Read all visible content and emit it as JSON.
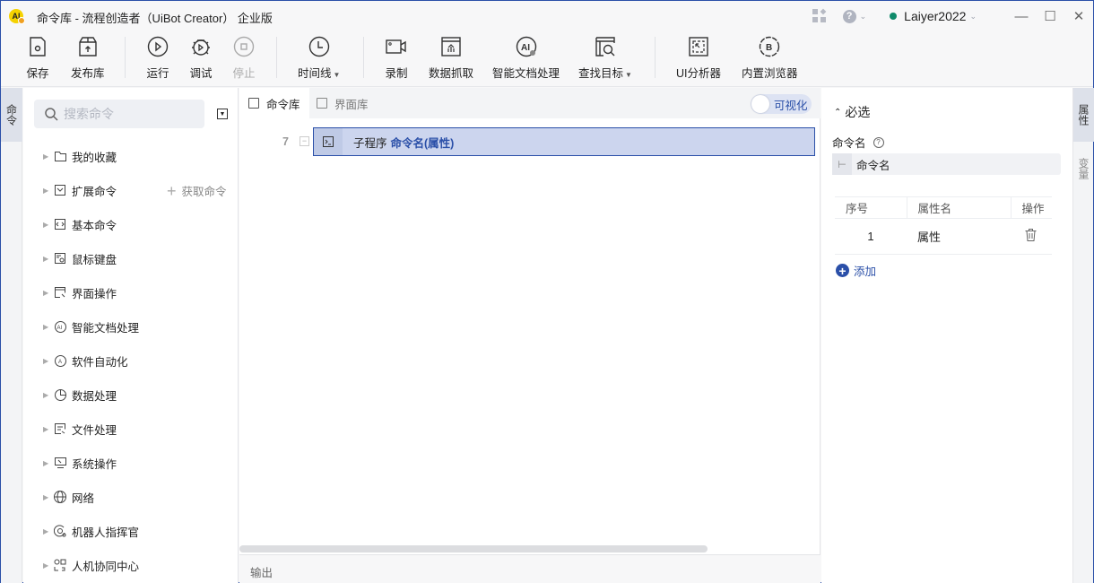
{
  "window": {
    "title": "命令库 - 流程创造者（UiBot Creator） 企业版",
    "logo_text": "Al",
    "user": "Laiyer2022",
    "status_color": "#0f8a6a"
  },
  "toolbar": {
    "items": [
      {
        "id": "save",
        "label": "保存",
        "icon": "save-icon"
      },
      {
        "id": "publish",
        "label": "发布库",
        "icon": "publish-box-icon"
      },
      {
        "id": "run",
        "label": "运行",
        "icon": "play-icon"
      },
      {
        "id": "debug",
        "label": "调试",
        "icon": "bug-icon"
      },
      {
        "id": "stop",
        "label": "停止",
        "icon": "stop-icon",
        "disabled": true
      },
      {
        "id": "timeline",
        "label": "时间线",
        "icon": "clock-icon",
        "dropdown": true
      },
      {
        "id": "record",
        "label": "录制",
        "icon": "camera-icon"
      },
      {
        "id": "scrape",
        "label": "数据抓取",
        "icon": "data-scrape-icon"
      },
      {
        "id": "idp",
        "label": "智能文档处理",
        "icon": "ai-doc-icon"
      },
      {
        "id": "find_target",
        "label": "查找目标",
        "icon": "find-target-icon",
        "dropdown": true
      },
      {
        "id": "ui_analyzer",
        "label": "UI分析器",
        "icon": "ui-analyzer-icon"
      },
      {
        "id": "browser",
        "label": "内置浏览器",
        "icon": "browser-icon"
      }
    ]
  },
  "left_vtab": {
    "label": "命令"
  },
  "commands": {
    "search_placeholder": "搜索命令",
    "get_commands_label": "获取命令",
    "categories": [
      {
        "label": "我的收藏",
        "icon": "folder-icon"
      },
      {
        "label": "扩展命令",
        "icon": "extension-icon"
      },
      {
        "label": "基本命令",
        "icon": "code-icon"
      },
      {
        "label": "鼠标键盘",
        "icon": "mouse-keyboard-icon"
      },
      {
        "label": "界面操作",
        "icon": "window-cursor-icon"
      },
      {
        "label": "智能文档处理",
        "icon": "ai-doc-icon"
      },
      {
        "label": "软件自动化",
        "icon": "automation-icon"
      },
      {
        "label": "数据处理",
        "icon": "pie-chart-icon"
      },
      {
        "label": "文件处理",
        "icon": "file-icon"
      },
      {
        "label": "系统操作",
        "icon": "monitor-icon"
      },
      {
        "label": "网络",
        "icon": "globe-icon"
      },
      {
        "label": "机器人指挥官",
        "icon": "commander-icon"
      },
      {
        "label": "人机协同中心",
        "icon": "collab-icon"
      }
    ]
  },
  "editor": {
    "tabs": [
      {
        "label": "命令库",
        "active": true
      },
      {
        "label": "界面库",
        "active": false
      }
    ],
    "visualize_label": "可视化",
    "lines": [
      {
        "number": "7",
        "keyword": "子程序",
        "name": "命令名(属性)"
      }
    ],
    "output_label": "输出"
  },
  "properties": {
    "section_title": "必选",
    "field_label": "命令名",
    "field_value": "命令名",
    "table": {
      "headers": [
        "序号",
        "属性名",
        "操作"
      ],
      "rows": [
        {
          "index": "1",
          "name": "属性"
        }
      ]
    },
    "add_label": "添加"
  },
  "right_vtabs": [
    {
      "label": "属性",
      "active": true
    },
    {
      "label": "变量",
      "active": false
    }
  ]
}
